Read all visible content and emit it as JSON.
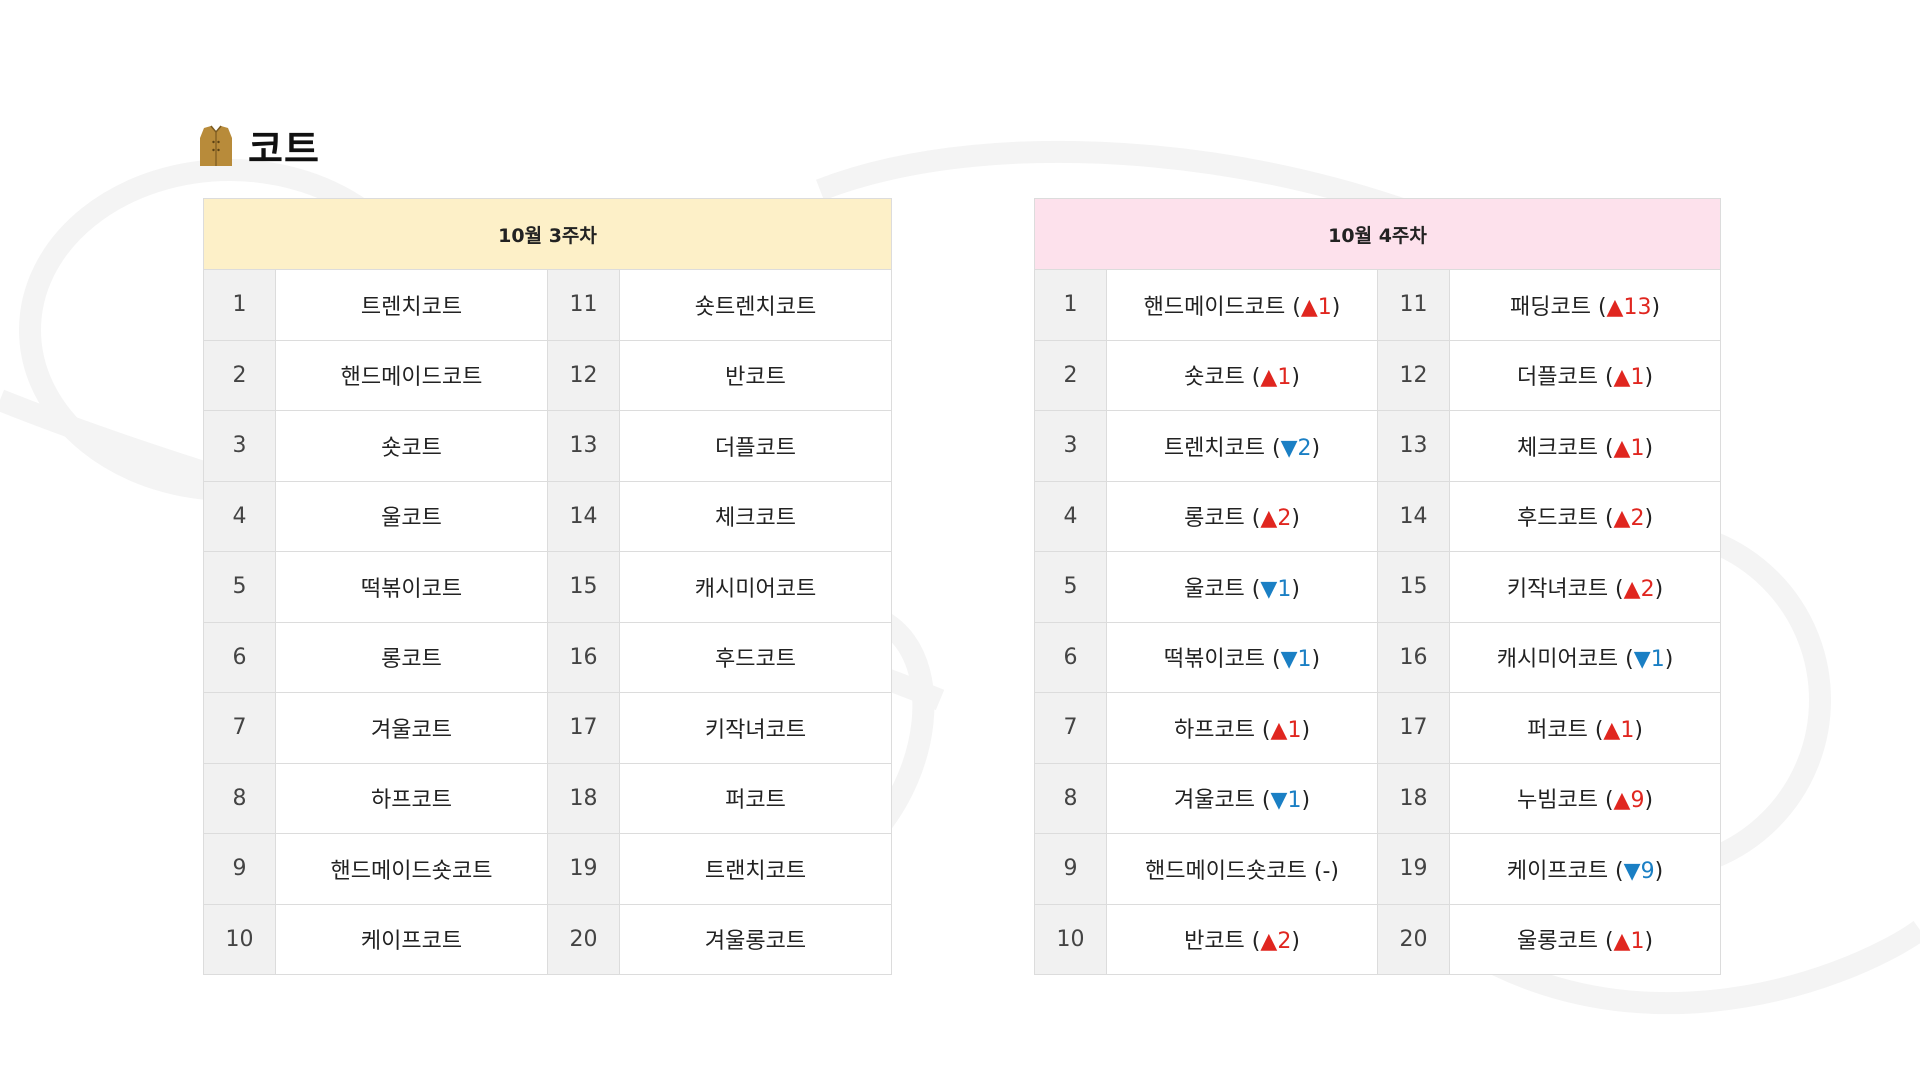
{
  "section": {
    "title": "코트",
    "icon": "coat-icon"
  },
  "colors": {
    "up": "#e0261f",
    "down": "#1a7fc4",
    "week3_header_bg": "#fdf0c8",
    "week4_header_bg": "#fde1ec"
  },
  "week3": {
    "header": "10월 3주차",
    "left": [
      {
        "rank": "1",
        "name": "트렌치코트"
      },
      {
        "rank": "2",
        "name": "핸드메이드코트"
      },
      {
        "rank": "3",
        "name": "숏코트"
      },
      {
        "rank": "4",
        "name": "울코트"
      },
      {
        "rank": "5",
        "name": "떡볶이코트"
      },
      {
        "rank": "6",
        "name": "롱코트"
      },
      {
        "rank": "7",
        "name": "겨울코트"
      },
      {
        "rank": "8",
        "name": "하프코트"
      },
      {
        "rank": "9",
        "name": "핸드메이드숏코트"
      },
      {
        "rank": "10",
        "name": "케이프코트"
      }
    ],
    "right": [
      {
        "rank": "11",
        "name": "숏트렌치코트"
      },
      {
        "rank": "12",
        "name": "반코트"
      },
      {
        "rank": "13",
        "name": "더플코트"
      },
      {
        "rank": "14",
        "name": "체크코트"
      },
      {
        "rank": "15",
        "name": "캐시미어코트"
      },
      {
        "rank": "16",
        "name": "후드코트"
      },
      {
        "rank": "17",
        "name": "키작녀코트"
      },
      {
        "rank": "18",
        "name": "퍼코트"
      },
      {
        "rank": "19",
        "name": "트랜치코트"
      },
      {
        "rank": "20",
        "name": "겨울롱코트"
      }
    ]
  },
  "week4": {
    "header": "10월 4주차",
    "left": [
      {
        "rank": "1",
        "name": "핸드메이드코트",
        "dir": "up",
        "arrow": "▲",
        "change": "1"
      },
      {
        "rank": "2",
        "name": "숏코트",
        "dir": "up",
        "arrow": "▲",
        "change": "1"
      },
      {
        "rank": "3",
        "name": "트렌치코트",
        "dir": "down",
        "arrow": "▼",
        "change": "2"
      },
      {
        "rank": "4",
        "name": "롱코트",
        "dir": "up",
        "arrow": "▲",
        "change": "2"
      },
      {
        "rank": "5",
        "name": "울코트",
        "dir": "down",
        "arrow": "▼",
        "change": "1"
      },
      {
        "rank": "6",
        "name": "떡볶이코트",
        "dir": "down",
        "arrow": "▼",
        "change": "1"
      },
      {
        "rank": "7",
        "name": "하프코트",
        "dir": "up",
        "arrow": "▲",
        "change": "1"
      },
      {
        "rank": "8",
        "name": "겨울코트",
        "dir": "down",
        "arrow": "▼",
        "change": "1"
      },
      {
        "rank": "9",
        "name": "핸드메이드숏코트",
        "dir": "same",
        "arrow": "",
        "change": "-"
      },
      {
        "rank": "10",
        "name": "반코트",
        "dir": "up",
        "arrow": "▲",
        "change": "2"
      }
    ],
    "right": [
      {
        "rank": "11",
        "name": "패딩코트",
        "dir": "up",
        "arrow": "▲",
        "change": "13"
      },
      {
        "rank": "12",
        "name": "더플코트",
        "dir": "up",
        "arrow": "▲",
        "change": "1"
      },
      {
        "rank": "13",
        "name": "체크코트",
        "dir": "up",
        "arrow": "▲",
        "change": "1"
      },
      {
        "rank": "14",
        "name": "후드코트",
        "dir": "up",
        "arrow": "▲",
        "change": "2"
      },
      {
        "rank": "15",
        "name": "키작녀코트",
        "dir": "up",
        "arrow": "▲",
        "change": "2"
      },
      {
        "rank": "16",
        "name": "캐시미어코트",
        "dir": "down",
        "arrow": "▼",
        "change": "1"
      },
      {
        "rank": "17",
        "name": "퍼코트",
        "dir": "up",
        "arrow": "▲",
        "change": "1"
      },
      {
        "rank": "18",
        "name": "누빔코트",
        "dir": "up",
        "arrow": "▲",
        "change": "9"
      },
      {
        "rank": "19",
        "name": "케이프코트",
        "dir": "down",
        "arrow": "▼",
        "change": "9"
      },
      {
        "rank": "20",
        "name": "울롱코트",
        "dir": "up",
        "arrow": "▲",
        "change": "1"
      }
    ]
  }
}
